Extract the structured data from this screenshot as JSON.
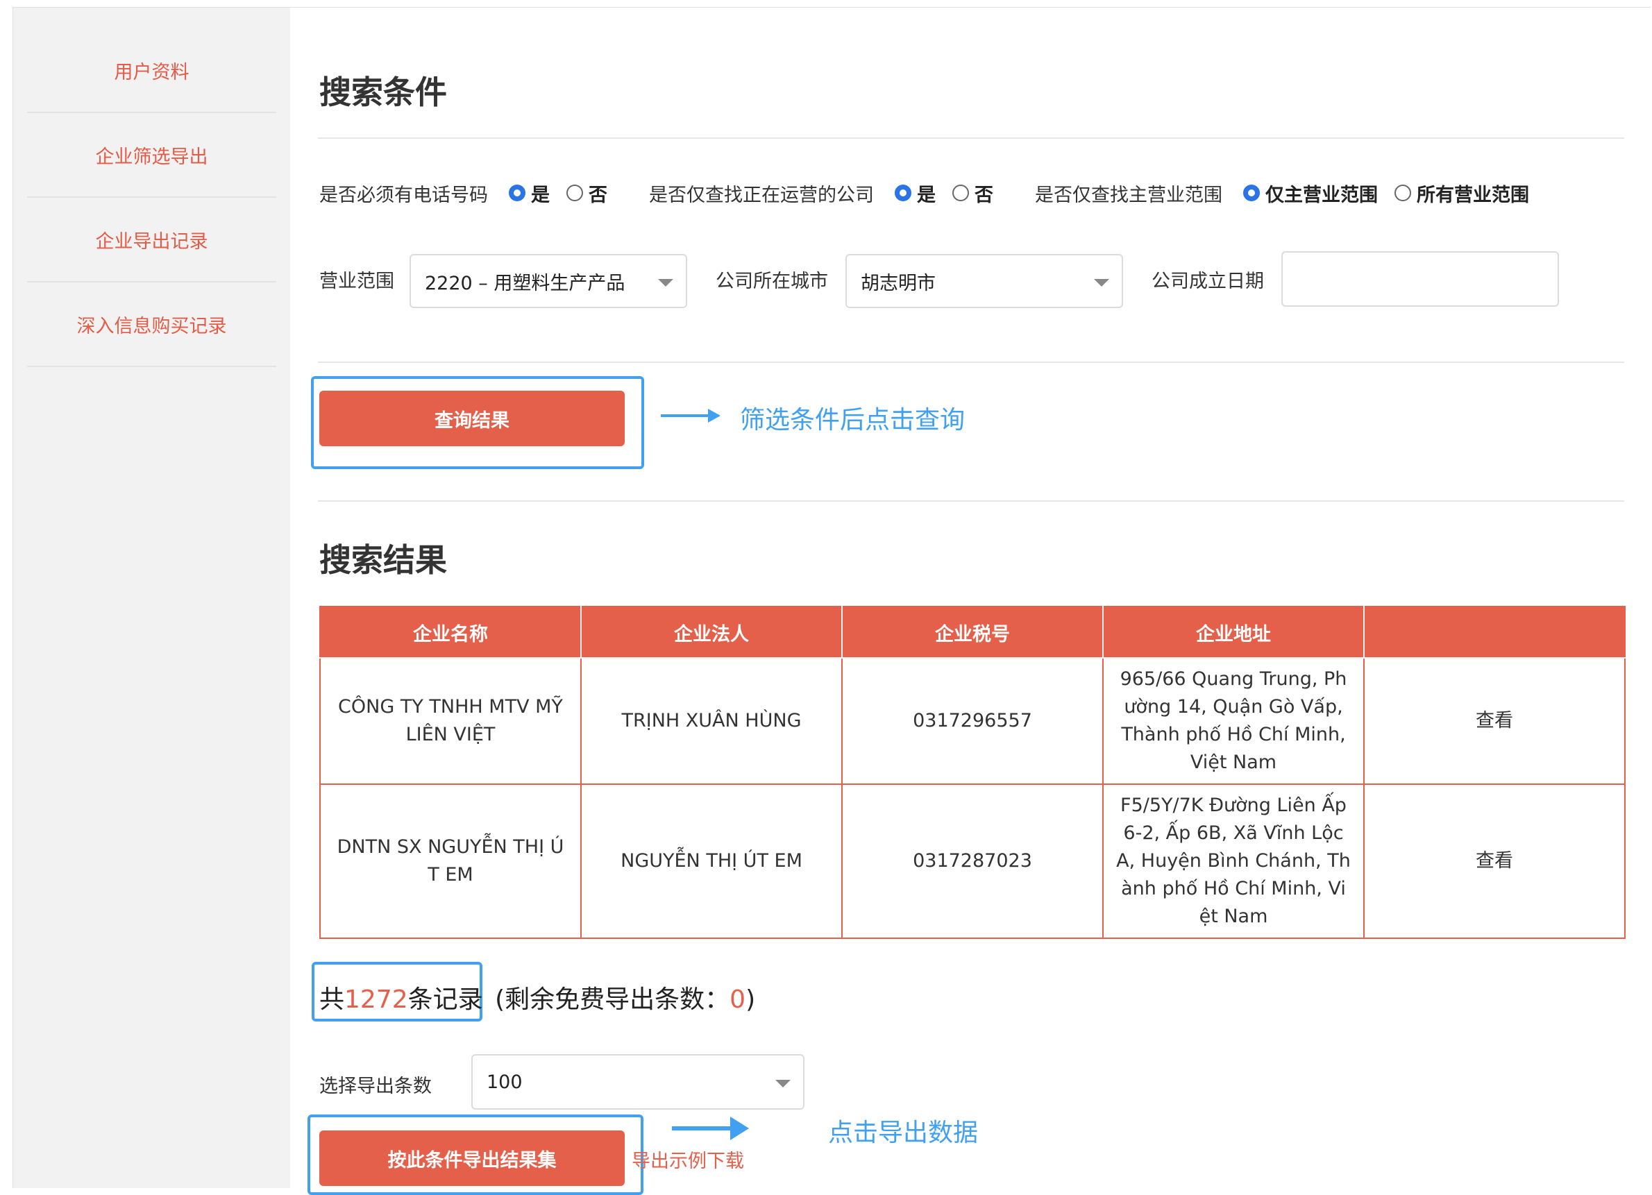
{
  "sidebar": {
    "items": [
      {
        "label": "用户资料"
      },
      {
        "label": "企业筛选导出"
      },
      {
        "label": "企业导出记录"
      },
      {
        "label": "深入信息购买记录"
      }
    ]
  },
  "search": {
    "title": "搜索条件",
    "phone_required": {
      "label": "是否必须有电话号码",
      "yes": "是",
      "no": "否",
      "selected": "yes"
    },
    "operating_only": {
      "label": "是否仅查找正在运营的公司",
      "yes": "是",
      "no": "否",
      "selected": "yes"
    },
    "main_scope_only": {
      "label": "是否仅查找主营业范围",
      "main": "仅主营业范围",
      "all": "所有营业范围",
      "selected": "main"
    },
    "business_scope": {
      "label": "营业范围",
      "value": "2220 – 用塑料生产产品"
    },
    "city": {
      "label": "公司所在城市",
      "value": "胡志明市"
    },
    "founded_date": {
      "label": "公司成立日期",
      "value": ""
    },
    "query_button": "查询结果",
    "query_hint": "筛选条件后点击查询"
  },
  "results": {
    "title": "搜索结果",
    "columns": [
      "企业名称",
      "企业法人",
      "企业税号",
      "企业地址",
      ""
    ],
    "rows": [
      {
        "name": "CÔNG TY TNHH MTV MỸ LIÊN VIỆT",
        "legal_rep": "TRỊNH XUÂN HÙNG",
        "tax_id": "0317296557",
        "address": "965/66 Quang Trung, Phường 14, Quận Gò Vấp, Thành phố Hồ Chí Minh, Việt Nam",
        "action": "查看"
      },
      {
        "name": "DNTN SX NGUYỄN THỊ ÚT EM",
        "legal_rep": "NGUYỄN THỊ ÚT EM",
        "tax_id": "0317287023",
        "address": "F5/5Y/7K Đường Liên Ấp 6-2, Ấp 6B, Xã Vĩnh Lộc A, Huyện Bình Chánh, Thành phố Hồ Chí Minh, Việt Nam",
        "action": "查看"
      }
    ],
    "count_prefix": "共",
    "count": "1272",
    "count_suffix": "条记录",
    "free_prefix": "(剩余免费导出条数：",
    "free_count": "0",
    "free_suffix": ")"
  },
  "export": {
    "count_label": "选择导出条数",
    "count_value": "100",
    "button": "按此条件导出结果集",
    "sample_link": "导出示例下载",
    "hint": "点击导出数据"
  },
  "colors": {
    "accent": "#e5604a",
    "annotation": "#41a1f0",
    "radio": "#2a74e6"
  }
}
